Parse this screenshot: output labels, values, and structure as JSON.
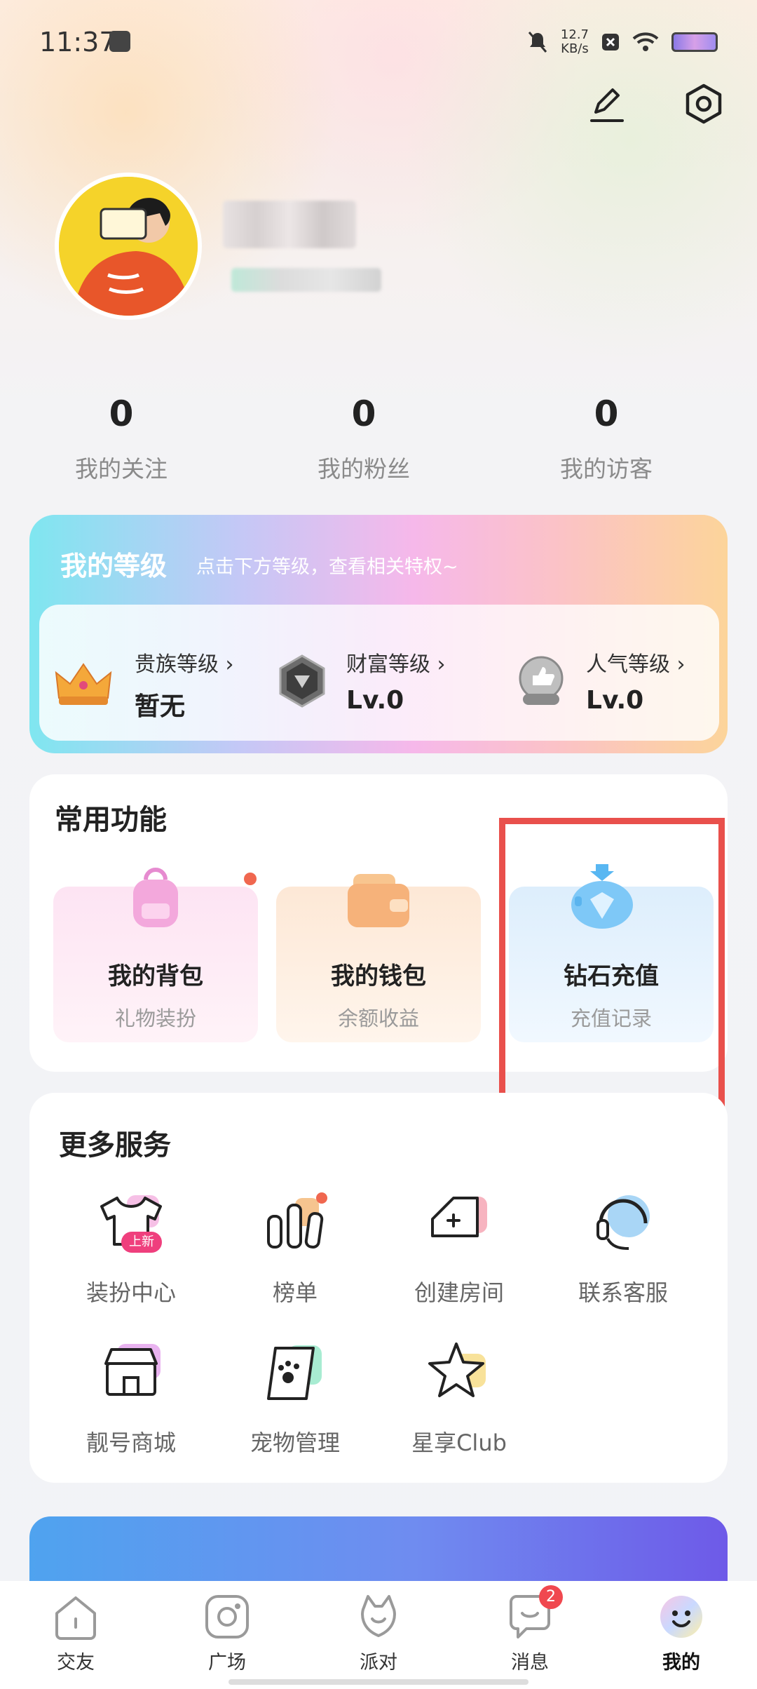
{
  "status_bar": {
    "time": "11:37",
    "net_speed_value": "12.7",
    "net_speed_unit": "KB/s"
  },
  "profile": {
    "stats": [
      {
        "value": "0",
        "label": "我的关注"
      },
      {
        "value": "0",
        "label": "我的粉丝"
      },
      {
        "value": "0",
        "label": "我的访客"
      }
    ]
  },
  "level_card": {
    "title": "我的等级",
    "subtitle": "点击下方等级，查看相关特权~",
    "items": [
      {
        "label": "贵族等级",
        "value": "暂无",
        "icon": "crown-icon"
      },
      {
        "label": "财富等级",
        "value": "Lv.0",
        "icon": "wealth-badge-icon"
      },
      {
        "label": "人气等级",
        "value": "Lv.0",
        "icon": "popularity-badge-icon"
      }
    ]
  },
  "common_functions": {
    "title": "常用功能",
    "items": [
      {
        "name": "我的背包",
        "sub": "礼物装扮",
        "icon": "backpack-icon"
      },
      {
        "name": "我的钱包",
        "sub": "余额收益",
        "icon": "wallet-icon"
      },
      {
        "name": "钻石充值",
        "sub": "充值记录",
        "icon": "diamond-piggy-icon"
      }
    ]
  },
  "more_services": {
    "title": "更多服务",
    "items": [
      {
        "label": "装扮中心",
        "icon": "shirt-icon",
        "badge": "上新"
      },
      {
        "label": "榜单",
        "icon": "ranking-icon"
      },
      {
        "label": "创建房间",
        "icon": "create-room-icon"
      },
      {
        "label": "联系客服",
        "icon": "headset-icon"
      },
      {
        "label": "靓号商城",
        "icon": "shop-icon"
      },
      {
        "label": "宠物管理",
        "icon": "pet-paw-icon"
      },
      {
        "label": "星享Club",
        "icon": "star-icon"
      }
    ]
  },
  "tabbar": [
    {
      "label": "交友",
      "icon": "home-icon"
    },
    {
      "label": "广场",
      "icon": "plaza-icon"
    },
    {
      "label": "派对",
      "icon": "party-icon"
    },
    {
      "label": "消息",
      "icon": "message-icon",
      "badge": "2"
    },
    {
      "label": "我的",
      "icon": "me-face-icon"
    }
  ],
  "colors": {
    "accent_red": "#e9504c",
    "badge_red": "#f0484f"
  }
}
